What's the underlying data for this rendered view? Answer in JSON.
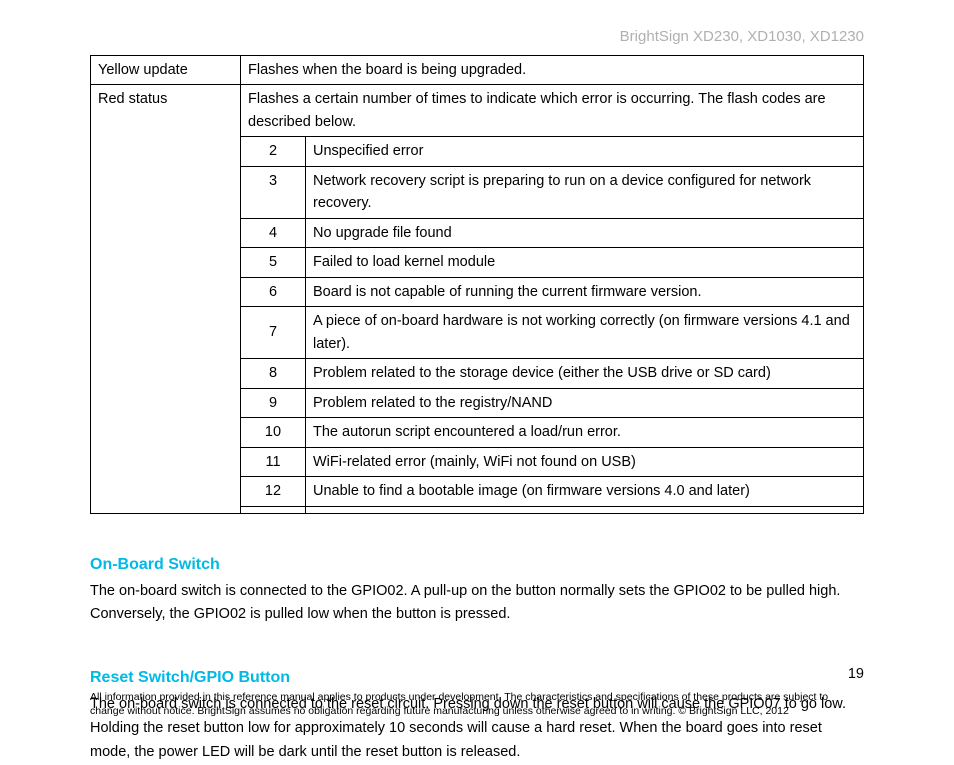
{
  "header": {
    "models": "BrightSign XD230, XD1030, XD1230"
  },
  "table": {
    "rows": [
      {
        "name": "Yellow update",
        "desc": "Flashes when the board is being upgraded."
      }
    ],
    "red_status": {
      "name": "Red status",
      "intro": "Flashes a certain number of times to indicate which error is occurring. The flash codes are described below.",
      "codes": [
        {
          "n": "2",
          "d": "Unspecified error"
        },
        {
          "n": "3",
          "d": "Network recovery script is preparing to run on a device configured for network recovery."
        },
        {
          "n": "4",
          "d": "No upgrade file found"
        },
        {
          "n": "5",
          "d": "Failed to load kernel module"
        },
        {
          "n": "6",
          "d": "Board is not capable of running the current firmware version."
        },
        {
          "n": "7",
          "d": "A piece of on-board hardware is not working correctly (on firmware versions 4.1 and later)."
        },
        {
          "n": "8",
          "d": "Problem related to the storage device (either the USB drive or SD card)"
        },
        {
          "n": "9",
          "d": "Problem related to the registry/NAND"
        },
        {
          "n": "10",
          "d": "The autorun script encountered a load/run error."
        },
        {
          "n": "11",
          "d": "WiFi-related error (mainly, WiFi not found on USB)"
        },
        {
          "n": "12",
          "d": "Unable to find a bootable image (on firmware versions 4.0 and later)"
        },
        {
          "n": "",
          "d": ""
        }
      ]
    }
  },
  "sections": [
    {
      "title": "On-Board Switch",
      "body": "The on-board switch is connected to the GPIO02. A pull-up on the button normally sets the GPIO02 to be pulled high. Conversely, the GPIO02 is pulled low when the button is pressed."
    },
    {
      "title": "Reset Switch/GPIO Button",
      "body": "The on-board switch is connected to the reset circuit. Pressing down the reset button will cause the GPIO07 to go low. Holding the reset button low for approximately 10 seconds will cause a hard reset. When the board goes into reset mode, the power LED will be dark until the reset button is released."
    }
  ],
  "page_number": "19",
  "footer": "All information provided in this reference manual applies to products under development. The characteristics and specifications of these products are subject to change without notice. BrightSign assumes no obligation regarding future manufacturing unless otherwise agreed to in writing. © BrightSign LLC, 2012"
}
